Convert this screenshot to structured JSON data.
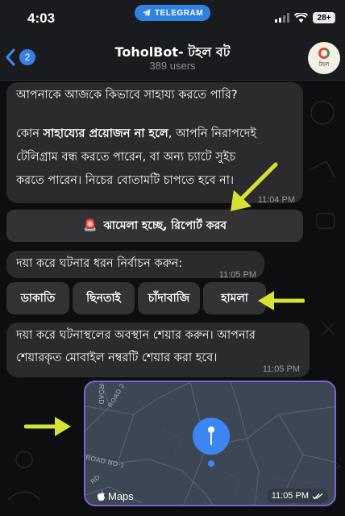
{
  "status_bar": {
    "time": "4:03",
    "telegram_label": "TELEGRAM",
    "battery": "28+"
  },
  "header": {
    "back_badge": "2",
    "title": "ToholBot- টহল বট",
    "subtitle": "389 users",
    "avatar_text": "টহল"
  },
  "messages": {
    "m1": {
      "line1": "আপনাকে আজকে কিভাবে সাহায্য করতে পারি?",
      "line2_prefix": "কোন ",
      "line2_bold": "সাহায্যের প্রয়োজন না হলে",
      "line2_suffix": ", আপনি নিরাপদেই",
      "line3": "টেলিগ্রাম বন্ধ করতে পারেন, বা অন্য চ্যাটে সুইচ",
      "line4": "করতে পারেন। নিচের বোতামটি চাপতে হবে না।",
      "time": "11:04 PM"
    },
    "report_button": {
      "icon": "🚨",
      "label": "ঝামেলা হচ্ছে, রিপোর্ট করব"
    },
    "m2": {
      "text": "দয়া করে ঘটনার ধরন নির্বাচন করুন:",
      "time": "11:05 PM"
    },
    "incident_buttons": [
      "ডাকাতি",
      "ছিনতাই",
      "চাঁদাবাজি",
      "হামলা"
    ],
    "m3": {
      "line1": "দয়া করে ঘটনাস্থলের অবস্থান শেয়ার করুন। আপনার",
      "line2": "শেয়ারকৃত মোবাইল নম্বরটি শেয়ার করা হবে।",
      "time": "11:05 PM"
    },
    "location": {
      "maps_label": "Maps",
      "time": "11:05 PM",
      "road_labels": [
        "ROAD 2",
        "ROAD NO-1",
        "RD",
        "G ROAD"
      ]
    }
  },
  "colors": {
    "accent": "#2e83e0",
    "bubble": "#2b2b2d",
    "arrow": "#d7e334",
    "map_border": "#7a63d8"
  }
}
